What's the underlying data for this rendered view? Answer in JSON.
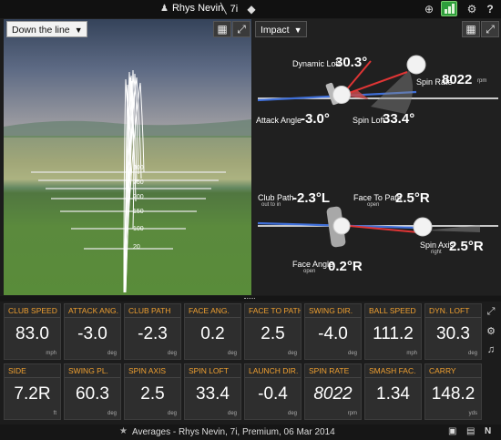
{
  "topbar": {
    "user": "Rhys Nevin",
    "club": "7i"
  },
  "view3d": {
    "view_select": "Down the line",
    "yard_markers": [
      "300",
      "250",
      "200",
      "150",
      "100",
      "50",
      "20"
    ]
  },
  "impact": {
    "view_select": "Impact",
    "dynamic_loft_label": "Dynamic Loft",
    "dynamic_loft_value": "30.3°",
    "spin_rate_label": "Spin Rate",
    "spin_rate_value": "8022",
    "spin_rate_unit": "rpm",
    "attack_angle_label": "Attack Angle",
    "attack_angle_value": "-3.0°",
    "spin_loft_label": "Spin Loft",
    "spin_loft_value": "33.4°",
    "club_path_label": "Club Path",
    "club_path_sub": "out to in",
    "club_path_value": "-2.3°L",
    "face_to_path_label": "Face To Path",
    "face_to_path_sub": "open",
    "face_to_path_value": "2.5°R",
    "spin_axis_label": "Spin Axis",
    "spin_axis_sub": "right",
    "spin_axis_value": "2.5°R",
    "face_angle_label": "Face Angle",
    "face_angle_sub": "open",
    "face_angle_value": "0.2°R"
  },
  "stats": [
    {
      "label": "CLUB SPEED",
      "value": "83.0",
      "unit": "mph"
    },
    {
      "label": "ATTACK ANG.",
      "value": "-3.0",
      "unit": "deg"
    },
    {
      "label": "CLUB PATH",
      "value": "-2.3",
      "unit": "deg"
    },
    {
      "label": "FACE ANG.",
      "value": "0.2",
      "unit": "deg"
    },
    {
      "label": "FACE TO PATH",
      "value": "2.5",
      "unit": "deg"
    },
    {
      "label": "SWING DIR.",
      "value": "-4.0",
      "unit": "deg"
    },
    {
      "label": "BALL SPEED",
      "value": "111.2",
      "unit": "mph"
    },
    {
      "label": "DYN. LOFT",
      "value": "30.3",
      "unit": "deg"
    },
    {
      "label": "SIDE",
      "value": "7.2R",
      "unit": "ft"
    },
    {
      "label": "SWING PL.",
      "value": "60.3",
      "unit": "deg"
    },
    {
      "label": "SPIN AXIS",
      "value": "2.5",
      "unit": "deg"
    },
    {
      "label": "SPIN LOFT",
      "value": "33.4",
      "unit": "deg"
    },
    {
      "label": "LAUNCH DIR.",
      "value": "-0.4",
      "unit": "deg"
    },
    {
      "label": "SPIN RATE",
      "value": "8022",
      "unit": "rpm"
    },
    {
      "label": "SMASH FAC.",
      "value": "1.34",
      "unit": ""
    },
    {
      "label": "CARRY",
      "value": "148.2",
      "unit": "yds"
    }
  ],
  "footer": {
    "text": "Averages - Rhys Nevin, 7i, Premium, 06 Mar 2014"
  },
  "colors": {
    "header_accent": "#f0a030",
    "battery": "#2e9e3b"
  }
}
